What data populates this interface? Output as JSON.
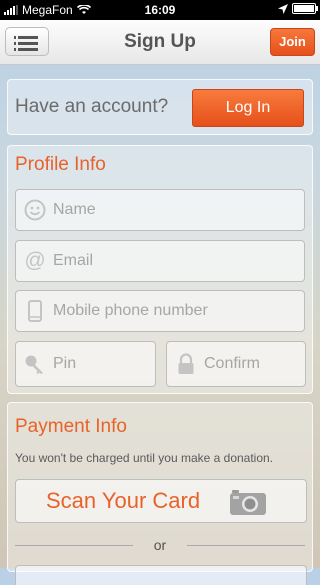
{
  "status_bar": {
    "carrier": "MegaFon",
    "time": "16:09"
  },
  "nav": {
    "title": "Sign Up",
    "join_label": "Join"
  },
  "account": {
    "prompt": "Have an account?",
    "login_label": "Log In"
  },
  "profile": {
    "title": "Profile Info",
    "fields": {
      "name": {
        "placeholder": "Name"
      },
      "email": {
        "placeholder": "Email"
      },
      "phone": {
        "placeholder": "Mobile phone number"
      },
      "pin": {
        "placeholder": "Pin"
      },
      "confirm": {
        "placeholder": "Confirm"
      }
    }
  },
  "payment": {
    "title": "Payment Info",
    "note": "You won't be charged until you make a donation.",
    "scan_label": "Scan Your Card",
    "or_label": "or"
  },
  "colors": {
    "accent": "#e9622a",
    "button": "#f0652a"
  },
  "icons": {
    "menu": "menu-icon",
    "smile": "smile-icon",
    "at": "at-icon",
    "phone": "phone-icon",
    "key": "key-icon",
    "lock": "lock-icon",
    "camera": "camera-icon"
  }
}
